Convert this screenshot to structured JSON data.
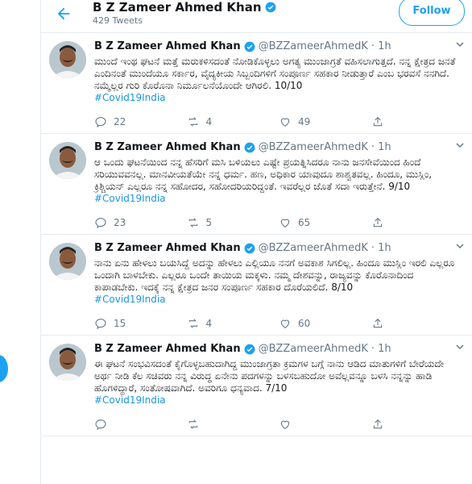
{
  "header": {
    "name": "B Z Zameer Ahmed Khan",
    "tweet_count": "429 Tweets",
    "follow_label": "Follow",
    "back_icon": "arrow-left-icon"
  },
  "colors": {
    "accent": "#1da1f2",
    "hashtag": "#1b95e0",
    "muted": "#657786",
    "border": "#e6ecf0"
  },
  "tweets": [
    {
      "name": "B Z Zameer Ahmed Khan",
      "handle": "@BZZameerAhmedK",
      "time": "· 1h",
      "text": "ಮುಂದೆ ಇಂಥ ಘಟನೆ ಮತ್ತೆ ಮರುಕಳಿಸದಂತೆ ನೋಡಿಕೊಳ್ಳಲು ಅಗತ್ಯ ಮುಂಜಾಗ್ರತೆ ವಹಿಸಲಾಗುತ್ತದೆ. ನನ್ನ ಕ್ಷೇತ್ರದ ಜನತೆ ಎಂದಿನಂತೆ ಮುಂದೆಯೂ ಸರ್ಕಾರ, ವೈದ್ಯಕೀಯ ಸಿಬ್ಬಂದಿಗಳಿಗೆ ಸಂಪೂರ್ಣ ಸಹಕಾರ ನೀಡುತ್ತಾರೆ ಎಂಬ ಭರವಸೆ ನನಗಿದೆ. ನಮ್ಮೆಲ್ಲರ ಗುರಿ ಕೊರೊನಾ ನಿರ್ಮೂಲನೆಯೊಂದೇ ಆಗಿರಲಿ. 10/10",
      "hashtag": "#Covid19India",
      "replies": "22",
      "retweets": "4",
      "likes": "49"
    },
    {
      "name": "B Z Zameer Ahmed Khan",
      "handle": "@BZZameerAhmedK",
      "time": "· 1h",
      "text": "ಆ ಒಂದು ಘಟನೆಯಿಂದ ನನ್ನ ಹೆಸರಿಗೆ ಮಸಿ ಬಳಿಯಲು ಎಷ್ಟೇ ಪ್ರಯತ್ನಿಸಿದರೂ ನಾನು ಜನಸೇವೆಯಿಂದ ಹಿಂದೆ ಸರಿಯುವವನಲ್ಲ. ಮಾನವೀಯತೆಯೇ ನನ್ನ ಧರ್ಮ. ಹಣ, ಅಧಿಕಾರ ಯಾವುದೂ ಶಾಶ್ವತವಲ್ಲ. ಹಿಂದೂ, ಮುಸ್ಲಿಂ, ಕ್ರಿಶ್ಚಿಯನ್ ಎಲ್ಲರೂ ನನ್ನ ಸಹೋದರ, ಸಹೋದರಿಯರಿದ್ದಂತೆ. ಇವರೆಲ್ಲರ ಜೊತೆ ಸದಾ ಇರುತ್ತೇನೆ. 9/10",
      "hashtag": "#Covid19India",
      "replies": "23",
      "retweets": "5",
      "likes": "65"
    },
    {
      "name": "B Z Zameer Ahmed Khan",
      "handle": "@BZZameerAhmedK",
      "time": "· 1h",
      "text": "ನಾನು ಏನು ಹೇಳಲು ಬಯಸಿದ್ದೆ ಅದನ್ನು ಹೇಳಲು ಎಲ್ಲಿಯೂ ನನಗೆ ಅವಕಾಶ ಸಿಗಲಿಲ್ಲ. ಹಿಂದೂ ಮುಸ್ಲಿಂ ಇರಲಿ ಎಲ್ಲರೂ ಒಂದಾಗಿ ಬಾಳಬೇಕು. ಎಲ್ಲರೂ ಒಂದೇ ತಾಯಿಯ ಮಕ್ಕಳು. ನಮ್ಮ ದೇಶವನ್ನು, ರಾಜ್ಯವನ್ನು ಕೊರೊನಾದಿಂದ ಕಾಪಾಡಬೇಕು. ಇದಕ್ಕೆ ನನ್ನ ಕ್ಷೇತ್ರದ ಜನರ ಸಂಪೂರ್ಣ ಸಹಕಾರ ದೊರೆಯಲಿದೆ. 8/10",
      "hashtag": "#Covid19India",
      "replies": "15",
      "retweets": "4",
      "likes": "60"
    },
    {
      "name": "B Z Zameer Ahmed Khan",
      "handle": "@BZZameerAhmedK",
      "time": "· 1h",
      "text": "ಈ ಘಟನೆ ಸಂಭವಿಸದಂತೆ ಕೈಗೊಳ್ಳಬಹುದಾಗಿದ್ದ ಮುಂಜಾಗ್ರತಾ ಕ್ರಮಗಳ ಬಗ್ಗೆ ನಾನು ಆಡಿದ ಮಾತುಗಳಿಗೆ ಬೇರೆಯದೇ ಅರ್ಥ ನೀಡಿ ಕೆಲ ಸಚಿವರು ನನ್ನ ವಿರುದ್ಧ ಏನೇನು ಪದಗಳನ್ನು ಬಳಸಬಹುದೋ ಅವೆಲ್ಲವನ್ನೂ ಬಳಸಿ ನನ್ನನ್ನು ಹಾಡಿ ಹೊಗಳಿದ್ದಾರೆ, ಸಂತೋಷವಾಗಿದೆ. ಅವರಿಗೂ ಧನ್ಯವಾದ. 7/10",
      "hashtag": "#Covid19India",
      "replies": "",
      "retweets": "",
      "likes": ""
    }
  ]
}
